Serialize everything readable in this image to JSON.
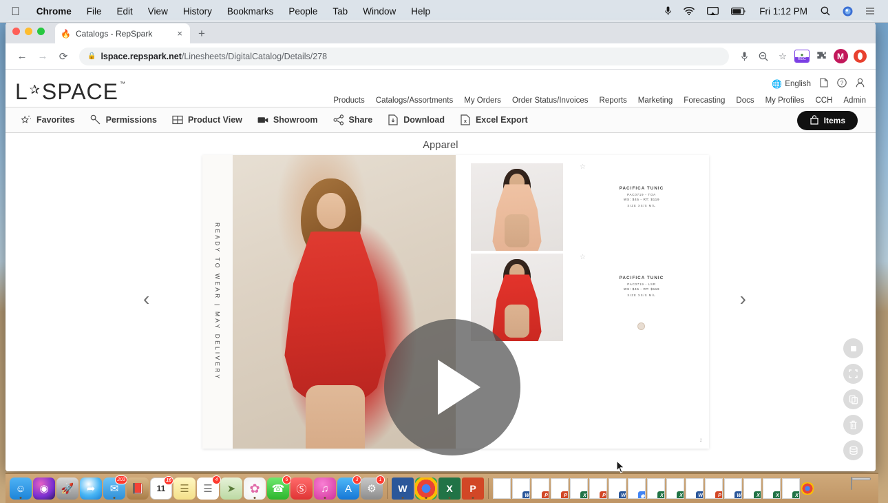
{
  "menubar": {
    "apple": "apple-logo",
    "items": [
      {
        "label": "Chrome",
        "bold": true
      },
      {
        "label": "File",
        "bold": false
      },
      {
        "label": "Edit",
        "bold": false
      },
      {
        "label": "View",
        "bold": false
      },
      {
        "label": "History",
        "bold": false
      },
      {
        "label": "Bookmarks",
        "bold": false
      },
      {
        "label": "People",
        "bold": false
      },
      {
        "label": "Tab",
        "bold": false
      },
      {
        "label": "Window",
        "bold": false
      },
      {
        "label": "Help",
        "bold": false
      }
    ],
    "status_icons": [
      "microphone-icon",
      "wifi-icon",
      "airplay-icon",
      "battery-icon"
    ],
    "clock": "Fri 1:12 PM",
    "right_icons": [
      "spotlight-search-icon",
      "siri-icon",
      "control-center-icon"
    ]
  },
  "browser": {
    "tab": {
      "favicon": "repspark-flame-favicon",
      "title": "Catalogs - RepSpark",
      "close": "×"
    },
    "new_tab": "+",
    "nav": {
      "back": "←",
      "forward": "→",
      "reload": "⟳"
    },
    "url": {
      "lock": "lock-icon",
      "domain": "lspace.repspark.net",
      "path": "/Linesheets/DigitalCatalog/Details/278"
    },
    "omni_icons": [
      "microphone-icon",
      "zoom-out-icon",
      "bookmark-star-icon"
    ],
    "extensions": {
      "screen_recorder_label": "REC",
      "puzzle": "extensions-puzzle-icon",
      "profile_initial": "M",
      "opera": "opera-icon"
    }
  },
  "site": {
    "logo": {
      "pre": "L",
      "star": "✰",
      "post": "SPACE",
      "tm": "™"
    },
    "utility": {
      "language_label": "English",
      "globe": "globe-icon",
      "doc": "document-icon",
      "help": "help-circle-icon",
      "account": "user-account-icon"
    },
    "nav": [
      "Products",
      "Catalogs/Assortments",
      "My Orders",
      "Order Status/Invoices",
      "Reports",
      "Marketing",
      "Forecasting",
      "Docs",
      "My Profiles",
      "CCH",
      "Admin"
    ],
    "toolbar": [
      {
        "label": "Favorites",
        "icon": "star-sparkle-icon"
      },
      {
        "label": "Permissions",
        "icon": "key-icon"
      },
      {
        "label": "Product View",
        "icon": "grid-icon"
      },
      {
        "label": "Showroom",
        "icon": "video-camera-icon"
      },
      {
        "label": "Share",
        "icon": "share-nodes-icon"
      },
      {
        "label": "Download",
        "icon": "download-file-icon"
      },
      {
        "label": "Excel Export",
        "icon": "excel-file-icon"
      }
    ],
    "items_button": {
      "label": "Items",
      "icon": "shopping-bag-icon"
    }
  },
  "catalog": {
    "title": "Apparel",
    "left_page": {
      "vertical_text": "READY TO WEAR  |  MAY DELIVERY"
    },
    "right_page": {
      "page_number": "2",
      "products": [
        {
          "name": "PACIFICA TUNIC",
          "sku": "PAC0719 - TOA",
          "price": "WS: $45 - RT: $119",
          "sizes": "SIZE   XS/S   M/L"
        },
        {
          "name": "PACIFICA TUNIC",
          "sku": "PAC0719 - LSR",
          "price": "WS: $45 - RT: $119",
          "sizes": "SIZE   XS/S   M/L"
        }
      ],
      "favorite_icon": "star-outline-icon",
      "swatch": "color-swatch"
    },
    "play_button": "play-video-icon",
    "prev_arrow": "‹",
    "next_arrow": "›",
    "side_tools": [
      {
        "icon": "stop-square-icon"
      },
      {
        "icon": "fullscreen-brackets-icon"
      },
      {
        "icon": "copy-pages-icon"
      },
      {
        "icon": "trash-icon"
      },
      {
        "icon": "layers-stack-icon"
      }
    ]
  },
  "dock": {
    "apps": [
      {
        "name": "finder",
        "glyph": "☰",
        "bg": "linear-gradient(180deg,#4fb3f5,#1d84d8)",
        "badge": "",
        "running": true
      },
      {
        "name": "siri",
        "glyph": "◉",
        "bg": "radial-gradient(circle at 35% 30%,#e661c4,#7a2fd0 60%,#2b1b5e)",
        "badge": "",
        "running": false
      },
      {
        "name": "launchpad",
        "glyph": "●",
        "bg": "linear-gradient(180deg,#d7d7d7,#8d8d8d)",
        "badge": "",
        "running": false
      },
      {
        "name": "safari",
        "glyph": "✦",
        "bg": "radial-gradient(circle at 40% 30%,#ffffff,#49b6f5 55%,#1b7fd4)",
        "badge": "",
        "running": false
      },
      {
        "name": "mail",
        "glyph": "✉",
        "bg": "linear-gradient(180deg,#6ec5f7,#2f8fd8)",
        "badge": "203",
        "running": true
      },
      {
        "name": "contacts",
        "glyph": "☰",
        "bg": "linear-gradient(180deg,#d8b98a,#a87c47)",
        "badge": "",
        "running": false
      },
      {
        "name": "calendar",
        "glyph": "11",
        "bg": "#ffffff",
        "badge": "16",
        "running": false
      },
      {
        "name": "notes",
        "glyph": "≡",
        "bg": "linear-gradient(180deg,#fff7c2,#f4e08a)",
        "badge": "",
        "running": false
      },
      {
        "name": "reminders",
        "glyph": "☰",
        "bg": "#ffffff",
        "badge": "4",
        "running": false
      },
      {
        "name": "maps",
        "glyph": "➤",
        "bg": "linear-gradient(180deg,#e6f2d8,#bcd9a3)",
        "badge": "",
        "running": false
      },
      {
        "name": "photos",
        "glyph": "✿",
        "bg": "radial-gradient(circle,#ffffff,#f0f0f0)",
        "badge": "",
        "running": true
      },
      {
        "name": "messages",
        "glyph": "✆",
        "bg": "linear-gradient(180deg,#6ee86e,#2db52d)",
        "badge": "6",
        "running": false
      },
      {
        "name": "news",
        "glyph": "⊘",
        "bg": "linear-gradient(180deg,#ff6b6b,#e03434)",
        "badge": "",
        "running": false
      },
      {
        "name": "itunes",
        "glyph": "♫",
        "bg": "radial-gradient(circle at 40% 30%,#f97fd4,#d0329a)",
        "badge": "",
        "running": true
      },
      {
        "name": "app-store",
        "glyph": "A",
        "bg": "linear-gradient(180deg,#4fb8f8,#1577d6)",
        "badge": "3",
        "running": false
      },
      {
        "name": "system-preferences",
        "glyph": "⚙",
        "bg": "linear-gradient(180deg,#c9c9c9,#8c8c8c)",
        "badge": "1",
        "running": false
      }
    ],
    "office_apps": [
      {
        "name": "microsoft-word",
        "glyph": "W",
        "bg": "#2b579a"
      },
      {
        "name": "google-chrome",
        "glyph": "◉",
        "bg": "#ffffff"
      },
      {
        "name": "microsoft-excel",
        "glyph": "X",
        "bg": "#217346"
      },
      {
        "name": "microsoft-powerpoint",
        "glyph": "P",
        "bg": "#d24726"
      }
    ],
    "minimized": [
      {
        "name": "barcode-doc",
        "app": "",
        "color": ""
      },
      {
        "name": "word-doc",
        "app": "W",
        "color": "#2b579a"
      },
      {
        "name": "ppt-doc",
        "app": "P",
        "color": "#d24726"
      },
      {
        "name": "ppt-doc-2",
        "app": "P",
        "color": "#d24726"
      },
      {
        "name": "excel-doc",
        "app": "X",
        "color": "#217346"
      },
      {
        "name": "ppt-doc-3",
        "app": "P",
        "color": "#d24726"
      },
      {
        "name": "word-doc-2",
        "app": "W",
        "color": "#2b579a"
      },
      {
        "name": "chrome-doc",
        "app": "◉",
        "color": "#4285f4"
      },
      {
        "name": "excel-doc-2",
        "app": "X",
        "color": "#217346"
      },
      {
        "name": "excel-doc-3",
        "app": "X",
        "color": "#217346"
      },
      {
        "name": "word-doc-3",
        "app": "W",
        "color": "#2b579a"
      },
      {
        "name": "ppt-doc-4",
        "app": "P",
        "color": "#d24726"
      },
      {
        "name": "word-doc-4",
        "app": "W",
        "color": "#2b579a"
      },
      {
        "name": "excel-doc-4",
        "app": "X",
        "color": "#217346"
      },
      {
        "name": "excel-doc-5",
        "app": "X",
        "color": "#217346"
      },
      {
        "name": "excel-doc-6",
        "app": "X",
        "color": "#217346"
      }
    ],
    "chrome_mini": {
      "name": "chrome-window-mini",
      "glyph": "◉"
    },
    "trash": {
      "name": "trash-can"
    }
  },
  "colors": {
    "accent_black": "#111111",
    "dress_red": "#d32f27",
    "chrome_gray": "#dee1e6",
    "dock_tan": "#bf9565"
  }
}
